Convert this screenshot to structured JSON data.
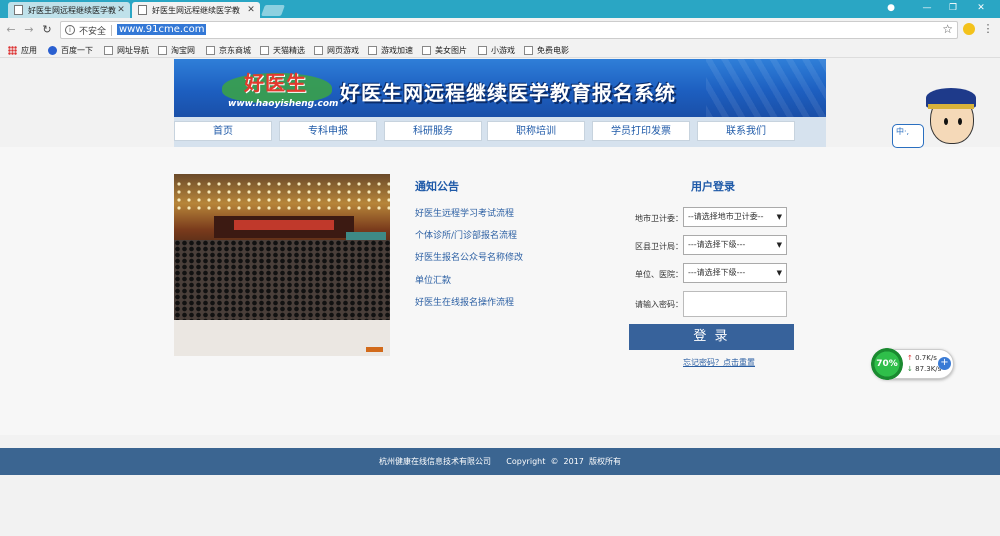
{
  "browser": {
    "tabs": [
      {
        "title": "好医生网远程继续医学教"
      },
      {
        "title": "好医生网远程继续医学教"
      }
    ],
    "security_label": "不安全",
    "url": "www.91cme.com",
    "bookmarks": [
      {
        "label": "应用",
        "icon": "apps-icon"
      },
      {
        "label": "百度一下",
        "icon": "baidu-paw-icon"
      },
      {
        "label": "网址导航",
        "icon": "page-icon"
      },
      {
        "label": "淘宝网",
        "icon": "page-icon"
      },
      {
        "label": "京东商城",
        "icon": "page-icon"
      },
      {
        "label": "天猫精选",
        "icon": "page-icon"
      },
      {
        "label": "网页游戏",
        "icon": "page-icon"
      },
      {
        "label": "游戏加速",
        "icon": "page-icon"
      },
      {
        "label": "美女图片",
        "icon": "page-icon"
      },
      {
        "label": "小游戏",
        "icon": "page-icon"
      },
      {
        "label": "免费电影",
        "icon": "page-icon"
      }
    ]
  },
  "header": {
    "logo_text": "好医生",
    "logo_url": "www.haoyisheng.com",
    "title": "好医生网远程继续医学教育报名系统"
  },
  "menu": [
    {
      "label": "首页"
    },
    {
      "label": "专科申报"
    },
    {
      "label": "科研服务"
    },
    {
      "label": "职称培训"
    },
    {
      "label": "学员打印发票"
    },
    {
      "label": "联系我们"
    }
  ],
  "notice": {
    "title": "通知公告",
    "items": [
      "好医生远程学习考试流程",
      "个体诊所/门诊部报名流程",
      "好医生报名公众号名称修改",
      "单位汇款",
      "好医生在线报名操作流程"
    ]
  },
  "login": {
    "title": "用户登录",
    "fields": [
      {
        "label": "地市卫计委：",
        "value": "--请选择地市卫计委--"
      },
      {
        "label": "区县卫计局：",
        "value": "---请选择下级---"
      },
      {
        "label": "单位、医院：",
        "value": "---请选择下级---"
      }
    ],
    "password_label": "请输入密码：",
    "submit": "登 录",
    "forgot": "忘记密码？点击重置"
  },
  "footer": {
    "company": "杭州健康在线信息技术有限公司",
    "copyright": "Copyright  ©  2017  版权所有"
  },
  "widgets": {
    "mascot_text": "中·,",
    "speed_percent": "70%",
    "upload": "0.7K/s",
    "download": "87.3K/s"
  }
}
